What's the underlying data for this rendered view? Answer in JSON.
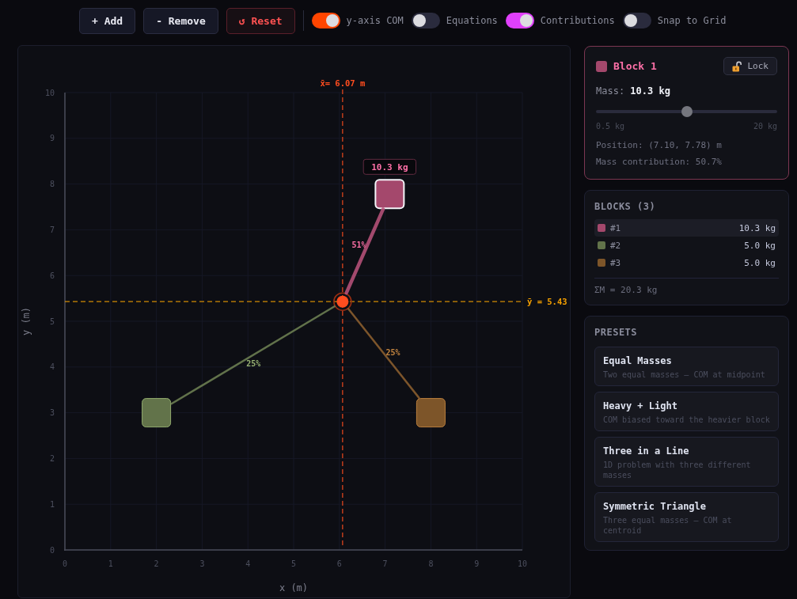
{
  "toolbar": {
    "buttons": [
      {
        "kind": "normal",
        "label": "+ Add"
      },
      {
        "kind": "normal",
        "label": "- Remove"
      },
      {
        "kind": "danger",
        "label": "↺ Reset"
      }
    ],
    "toggles": [
      {
        "label": "y-axis COM",
        "on": true,
        "color": "#ff4500"
      },
      {
        "label": "Equations",
        "on": false
      },
      {
        "label": "Contributions",
        "on": true,
        "color": "#e040fb"
      },
      {
        "label": "Snap to Grid",
        "on": false
      }
    ]
  },
  "canvas": {
    "blocks": [
      {
        "selected": true,
        "color": "#a4486c",
        "mass_label": "10.3 kg",
        "contribution": "51%"
      },
      {
        "selected": false,
        "color": "#62734a",
        "contribution": "25%"
      },
      {
        "selected": false,
        "color": "#7d5529",
        "contribution": "25%"
      }
    ],
    "chart_data": {
      "type": "scatter",
      "xlabel": "x (m)",
      "ylabel": "y (m)",
      "x": [
        7.1,
        2,
        8
      ],
      "series": [
        {
          "values": [
            7.78,
            3,
            3
          ]
        }
      ],
      "xlim": [
        0,
        10
      ],
      "ylim": [
        0,
        10
      ],
      "xticks": [
        0,
        1,
        2,
        3,
        4,
        5,
        6,
        7,
        8,
        9,
        10
      ],
      "yticks": [
        0,
        1,
        2,
        3,
        4,
        5,
        6,
        7,
        8,
        9,
        10
      ],
      "grid": true,
      "ref_lines": [
        {
          "axis": "x",
          "value": 6.07,
          "label": "x̄= 6.07 m",
          "color": "#ff4d1f"
        },
        {
          "axis": "y",
          "value": 5.43,
          "label": "ȳ = 5.43",
          "color": "#f5a000"
        }
      ]
    }
  },
  "selected_block": {
    "title": "Block 1",
    "color": "#a4486c",
    "lock_button": "Lock",
    "mass": "Mass: **10.3 kg**",
    "mass_slider": {
      "level": 0.5,
      "min_label": "0.5 kg",
      "max_label": "20 kg"
    },
    "position": "Position: (7.10, 7.78) m",
    "contribution": "Mass contribution: 50.7%"
  },
  "blocks": {
    "title": "BLOCKS (3)",
    "items": [
      {
        "label": "#1",
        "mass": "10.3 kg",
        "color": "#a4486c",
        "selected": true
      },
      {
        "label": "#2",
        "mass": "5.0 kg",
        "color": "#62734a",
        "selected": false
      },
      {
        "label": "#3",
        "mass": "5.0 kg",
        "color": "#7d5529",
        "selected": false
      }
    ],
    "total": "ΣM = 20.3 kg"
  },
  "presets": {
    "title": "PRESETS",
    "items": [
      {
        "title": "Equal Masses",
        "description": "Two equal masses — COM at midpoint"
      },
      {
        "title": "Heavy + Light",
        "description": "COM biased toward the heavier block"
      },
      {
        "title": "Three in a Line",
        "description": "1D problem with three different masses"
      },
      {
        "title": "Symmetric Triangle",
        "description": "Three equal masses — COM at centroid"
      }
    ]
  }
}
